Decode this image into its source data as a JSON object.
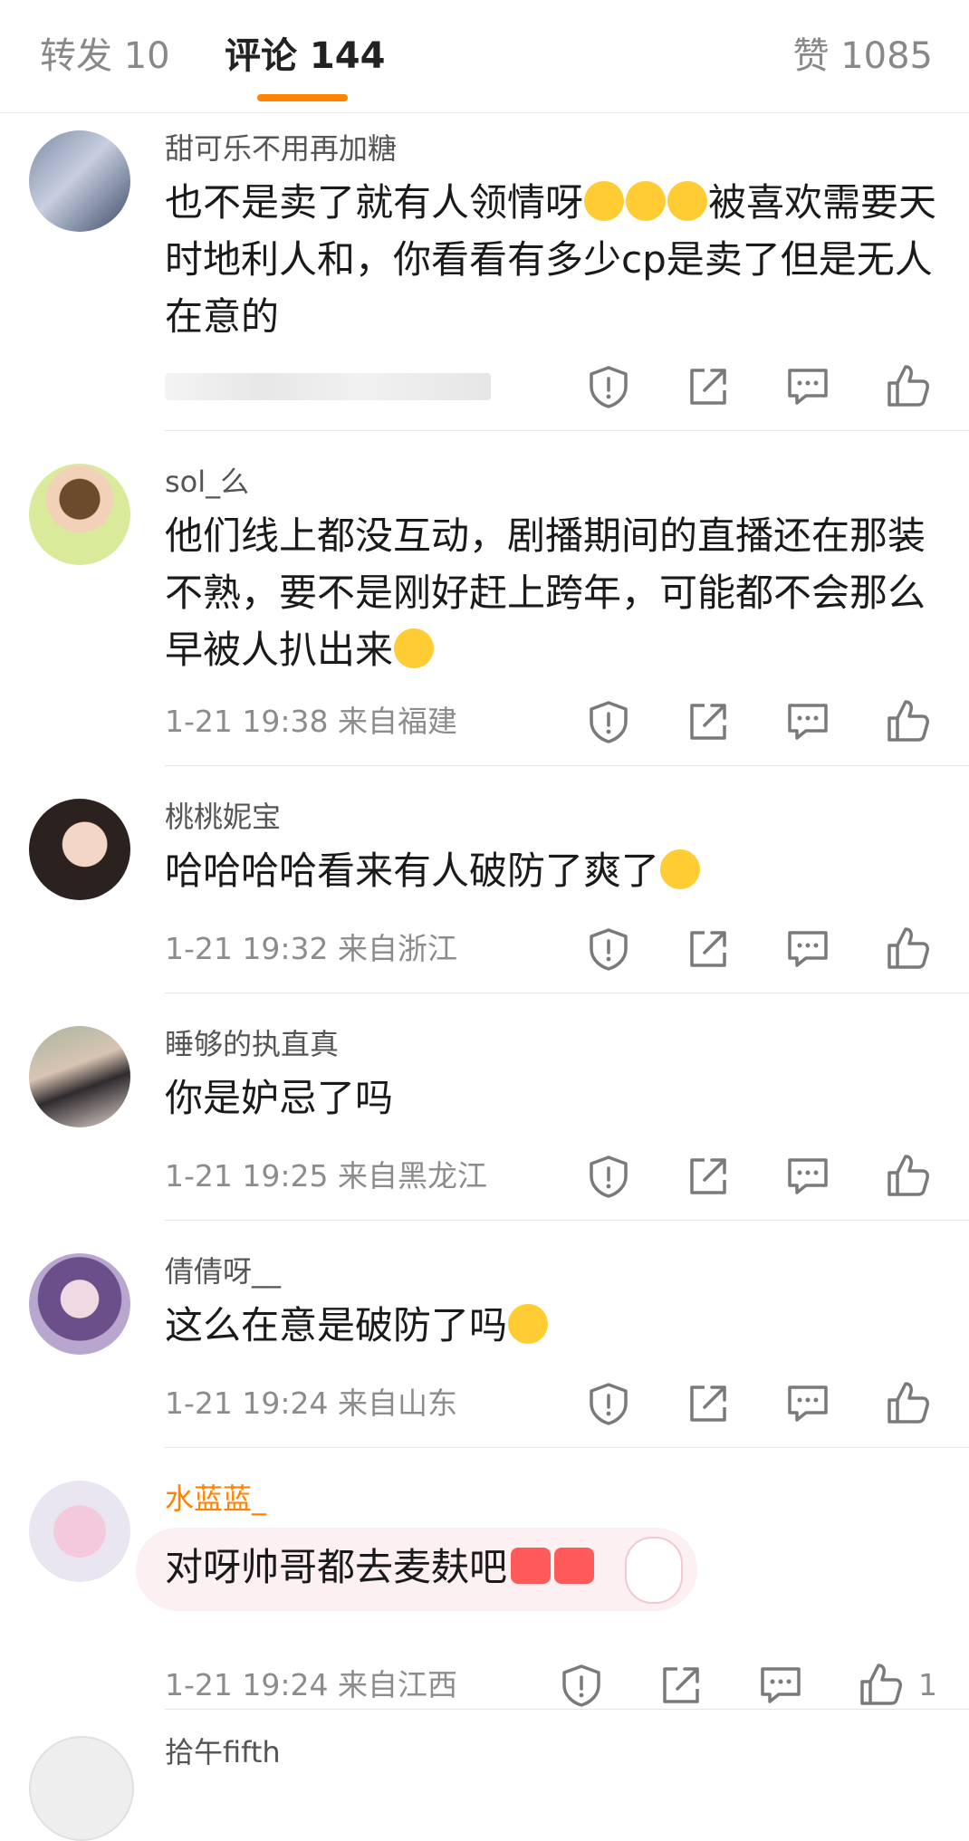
{
  "tabs": {
    "reposts": "转发 10",
    "comments": "评论 144",
    "likes": "赞 1085"
  },
  "colors": {
    "accent": "#ff8200",
    "meta": "#8c8c8c"
  },
  "comments": [
    {
      "username": "甜可乐不用再加糖",
      "text": "也不是卖了就有人领情呀",
      "text2": "被喜欢需要天时地利人和，你看看有多少cp是卖了但是无人在意的",
      "meta": ""
    },
    {
      "username": "sol_么",
      "text": "他们线上都没互动，剧播期间的直播还在那装不熟，要不是刚好赶上跨年，可能都不会那么早被人扒出来",
      "meta": "1-21 19:38 来自福建"
    },
    {
      "username": "桃桃妮宝",
      "text": "哈哈哈哈看来有人破防了爽了",
      "meta": "1-21 19:32 来自浙江"
    },
    {
      "username": "睡够的执直真",
      "text": "你是妒忌了吗",
      "meta": "1-21 19:25 来自黑龙江"
    },
    {
      "username": "倩倩呀__",
      "text": "这么在意是破防了吗",
      "meta": "1-21 19:24 来自山东"
    },
    {
      "username": "水蓝蓝_",
      "text": "对呀帅哥都去麦麸吧",
      "meta": "1-21 19:24 来自江西",
      "like_count": "1"
    },
    {
      "username": "拾午fifth"
    }
  ],
  "icons": [
    "report-icon",
    "share-icon",
    "reply-icon",
    "like-icon"
  ]
}
